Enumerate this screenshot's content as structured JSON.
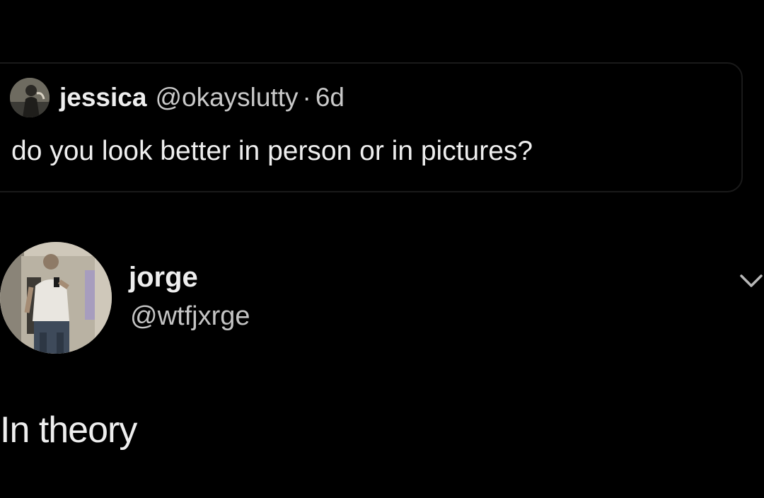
{
  "quoted_tweet": {
    "name": "jessica",
    "handle": "@okayslutty",
    "separator": "·",
    "time": "6d",
    "text": "do you look better in person or in pictures?",
    "avatar_icon": "user-photo-avatar"
  },
  "tweet": {
    "name": "jorge",
    "handle": "@wtfjxrge",
    "text": "In theory",
    "avatar_icon": "mirror-selfie-avatar",
    "more_icon": "chevron-down-icon"
  },
  "colors": {
    "background": "#000000",
    "primary_text": "#eeeeee",
    "secondary_text": "#c9c9c9",
    "card_border": "#1a1a1a"
  }
}
